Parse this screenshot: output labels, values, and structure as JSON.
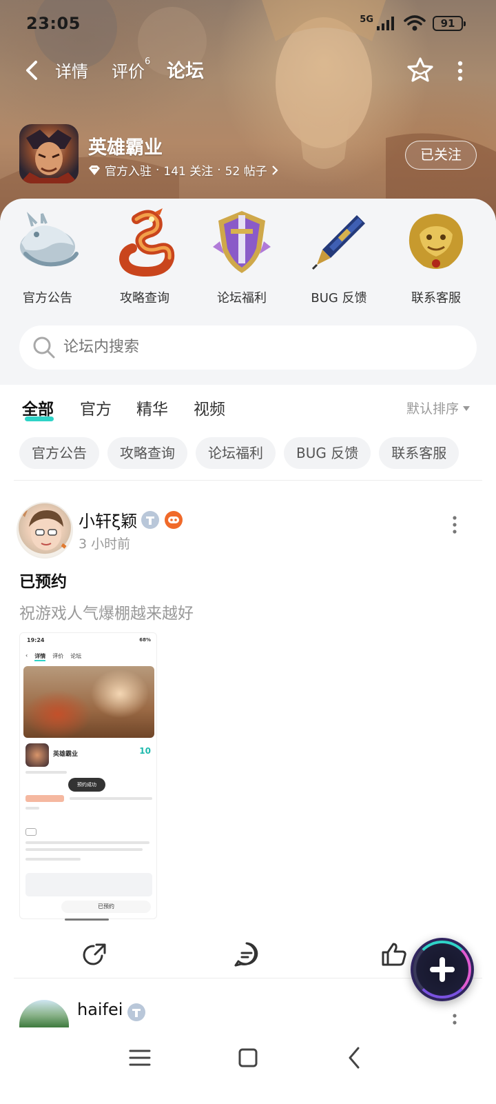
{
  "status_bar": {
    "time": "23:05",
    "network": "5G",
    "battery": "91"
  },
  "nav": {
    "tabs": [
      {
        "label": "详情"
      },
      {
        "label": "评价",
        "badge": "6"
      },
      {
        "label": "论坛"
      }
    ],
    "active_tab": "论坛"
  },
  "game": {
    "name": "英雄霸业",
    "official": "官方入驻",
    "followers": "141 关注",
    "posts": "52 帖子",
    "follow_button": "已关注"
  },
  "categories": [
    {
      "label": "官方公告",
      "icon": "silver-dragon-icon"
    },
    {
      "label": "攻略查询",
      "icon": "fire-dragon-icon"
    },
    {
      "label": "论坛福利",
      "icon": "purple-shield-sword-icon"
    },
    {
      "label": "BUG 反馈",
      "icon": "pen-icon"
    },
    {
      "label": "联系客服",
      "icon": "golden-lion-head-icon"
    }
  ],
  "search": {
    "placeholder": "论坛内搜索"
  },
  "filter_tabs": [
    {
      "label": "全部"
    },
    {
      "label": "官方"
    },
    {
      "label": "精华"
    },
    {
      "label": "视频"
    }
  ],
  "sort": "默认排序",
  "chips": [
    "官方公告",
    "攻略查询",
    "论坛福利",
    "BUG 反馈",
    "联系客服"
  ],
  "post": {
    "username": "小轩ξ颖",
    "time": "3 小时前",
    "title": "已预约",
    "body": "祝游戏人气爆棚越来越好",
    "screenshot": {
      "time": "19:24",
      "battery": "68%",
      "tabs": [
        "详情",
        "评价",
        "论坛"
      ],
      "game_name": "英雄霸业",
      "score": "10",
      "toast": "预约成功",
      "bottom_button": "已预约"
    }
  },
  "post2": {
    "username": "haifei"
  },
  "colors": {
    "accent": "#2fd3c7",
    "badge_orange": "#f06a2a"
  }
}
